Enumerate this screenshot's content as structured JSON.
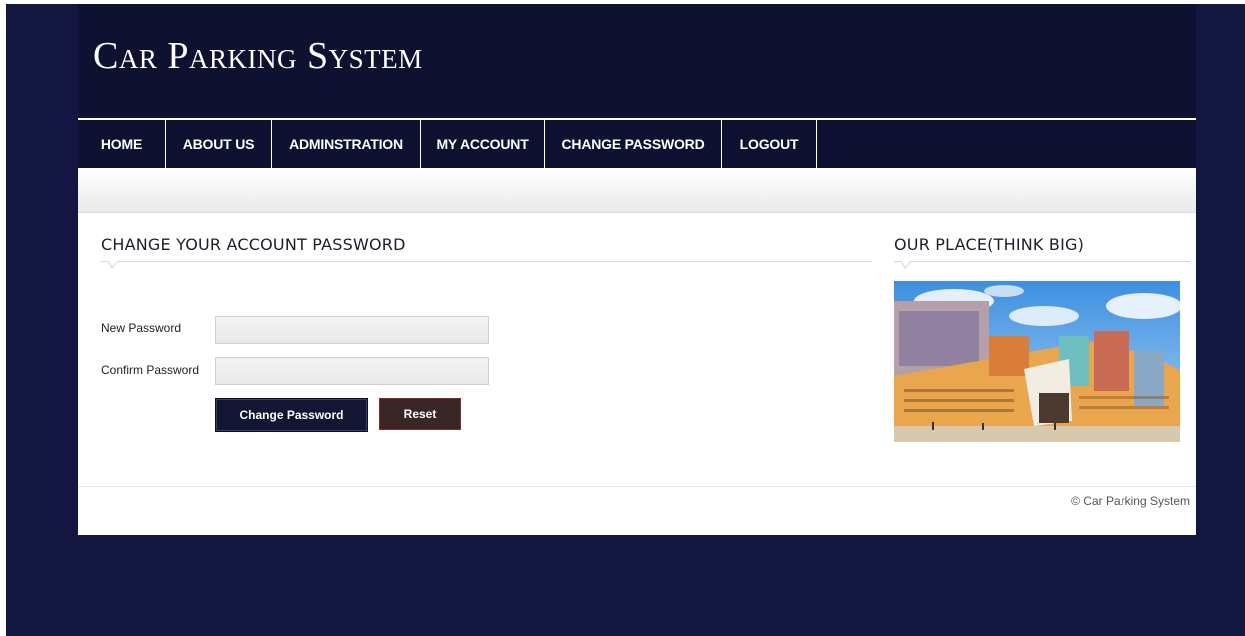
{
  "header": {
    "site_title": "Car Parking System"
  },
  "nav": {
    "items": [
      {
        "label": "HOME"
      },
      {
        "label": "ABOUT US"
      },
      {
        "label": "ADMINSTRATION"
      },
      {
        "label": "MY ACCOUNT"
      },
      {
        "label": "CHANGE PASSWORD"
      },
      {
        "label": "LOGOUT"
      }
    ]
  },
  "main": {
    "title": "CHANGE YOUR ACCOUNT PASSWORD",
    "form": {
      "new_password_label": "New Password",
      "new_password_value": "",
      "confirm_password_label": "Confirm Password",
      "confirm_password_value": "",
      "submit_label": "Change Password",
      "reset_label": "Reset"
    }
  },
  "sidebar": {
    "title": "OUR PLACE(THINK BIG)"
  },
  "footer": {
    "copyright": "© Car Parking System"
  },
  "colors": {
    "page_background": "#121641",
    "header_background": "#0e1130",
    "submit_button": "#121633",
    "reset_button": "#3b2627",
    "reset_border": "#8a2a2a"
  }
}
